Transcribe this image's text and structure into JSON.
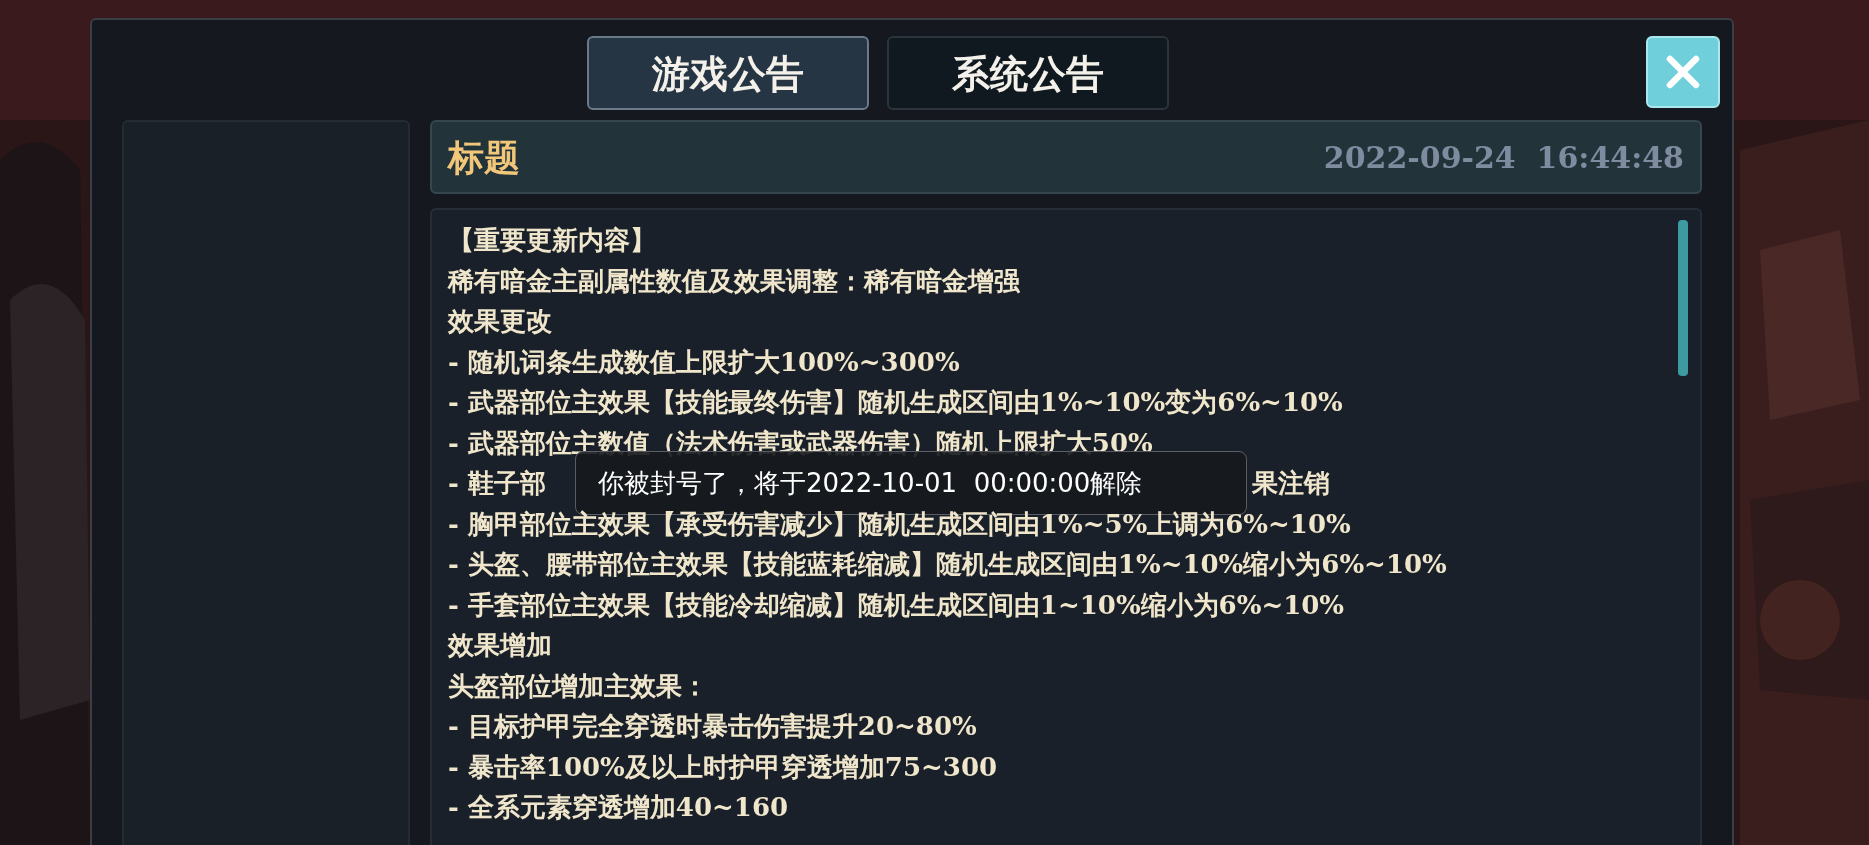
{
  "tabs": [
    {
      "label": "游戏公告",
      "selected": true
    },
    {
      "label": "系统公告",
      "selected": false
    }
  ],
  "notice": {
    "title": "标题",
    "date": "2022-09-24  16:44:48",
    "lines": [
      {
        "kind": "text",
        "text": "【重要更新内容】"
      },
      {
        "kind": "text",
        "text": "稀有暗金主副属性数值及效果调整：稀有暗金增强"
      },
      {
        "kind": "text",
        "text": "效果更改"
      },
      {
        "kind": "text",
        "text": "- 随机词条生成数值上限扩大100%~300%"
      },
      {
        "kind": "text",
        "text": "- 武器部位主效果【技能最终伤害】随机生成区间由1%~10%变为6%~10%"
      },
      {
        "kind": "text",
        "text": "- 武器部位主数值（法术伤害或武器伤害）随机上限扩大50%"
      },
      {
        "kind": "obscured",
        "start": "- 鞋子部",
        "end": "果注销"
      },
      {
        "kind": "text",
        "text": "- 胸甲部位主效果【承受伤害减少】随机生成区间由1%~5%上调为6%~10%"
      },
      {
        "kind": "text",
        "text": "- 头盔、腰带部位主效果【技能蓝耗缩减】随机生成区间由1%~10%缩小为6%~10%"
      },
      {
        "kind": "text",
        "text": "- 手套部位主效果【技能冷却缩减】随机生成区间由1~10%缩小为6%~10%"
      },
      {
        "kind": "text",
        "text": "效果增加"
      },
      {
        "kind": "text",
        "text": "头盔部位增加主效果："
      },
      {
        "kind": "text",
        "text": "- 目标护甲完全穿透时暴击伤害提升20~80%"
      },
      {
        "kind": "text",
        "text": "- 暴击率100%及以上时护甲穿透增加75~300"
      },
      {
        "kind": "text",
        "text": "- 全系元素穿透增加40~160"
      }
    ]
  },
  "toast": {
    "text": "你被封号了，将于2022-10-01  00:00:00解除"
  }
}
